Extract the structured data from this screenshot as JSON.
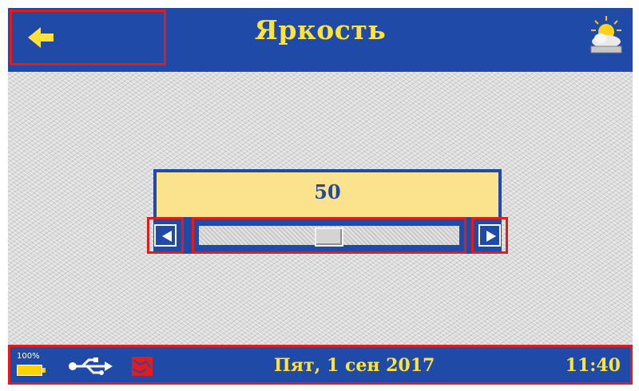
{
  "header": {
    "title": "Яркость",
    "back_icon": "arrow-left-icon",
    "weather_icon": "sun-cloud-icon"
  },
  "brightness": {
    "value": "50",
    "slider_level_percent": 50,
    "left_icon": "chevron-left-icon",
    "right_icon": "chevron-right-icon"
  },
  "footer": {
    "battery_percent": "100%",
    "usb_icon": "usb-icon",
    "flag_icon": "flag-icon",
    "date": "Пят, 1 сен 2017",
    "time": "11:40"
  },
  "colors": {
    "primary_blue": "#1f4aa8",
    "accent_yellow": "#ffe23a",
    "value_bg": "#fbe38e",
    "highlight_red": "#e21b1b"
  }
}
